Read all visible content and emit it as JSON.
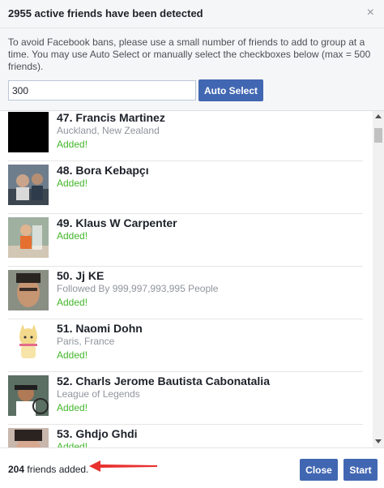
{
  "header": {
    "title": "2955 active friends have been detected",
    "close_glyph": "×"
  },
  "intro": {
    "text": "To avoid Facebook bans, please use a small number of friends to add to group at a time. You may use Auto Select or manually select the checkboxes below (max = 500 friends).",
    "input_value": "300",
    "auto_select_label": "Auto Select"
  },
  "friends": [
    {
      "name": "47. Francis Martinez",
      "sub": "Auckland, New Zealand",
      "status": "Added!",
      "avatar": "black"
    },
    {
      "name": "48. Bora Kebapçı",
      "sub": "",
      "status": "Added!",
      "avatar": "photo-group"
    },
    {
      "name": "49. Klaus W Carpenter",
      "sub": "",
      "status": "Added!",
      "avatar": "photo-child"
    },
    {
      "name": "50. Jj KE",
      "sub": "Followed By 999,997,993,995 People",
      "status": "Added!",
      "avatar": "photo-face"
    },
    {
      "name": "51. Naomi Dohn",
      "sub": "Paris, France",
      "status": "Added!",
      "avatar": "cartoon"
    },
    {
      "name": "52. Charls Jerome Bautista Cabonatalia",
      "sub": "League of Legends",
      "status": "Added!",
      "avatar": "photo-bike"
    },
    {
      "name": "53. Ghdjo Ghdi",
      "sub": "",
      "status": "Added!",
      "avatar": "photo-face2"
    }
  ],
  "footer": {
    "count": "204",
    "count_suffix": " friends added.",
    "close_label": "Close",
    "start_label": "Start"
  },
  "colors": {
    "accent": "#4267b2",
    "added": "#42b72a",
    "arrow": "#e8312f"
  }
}
